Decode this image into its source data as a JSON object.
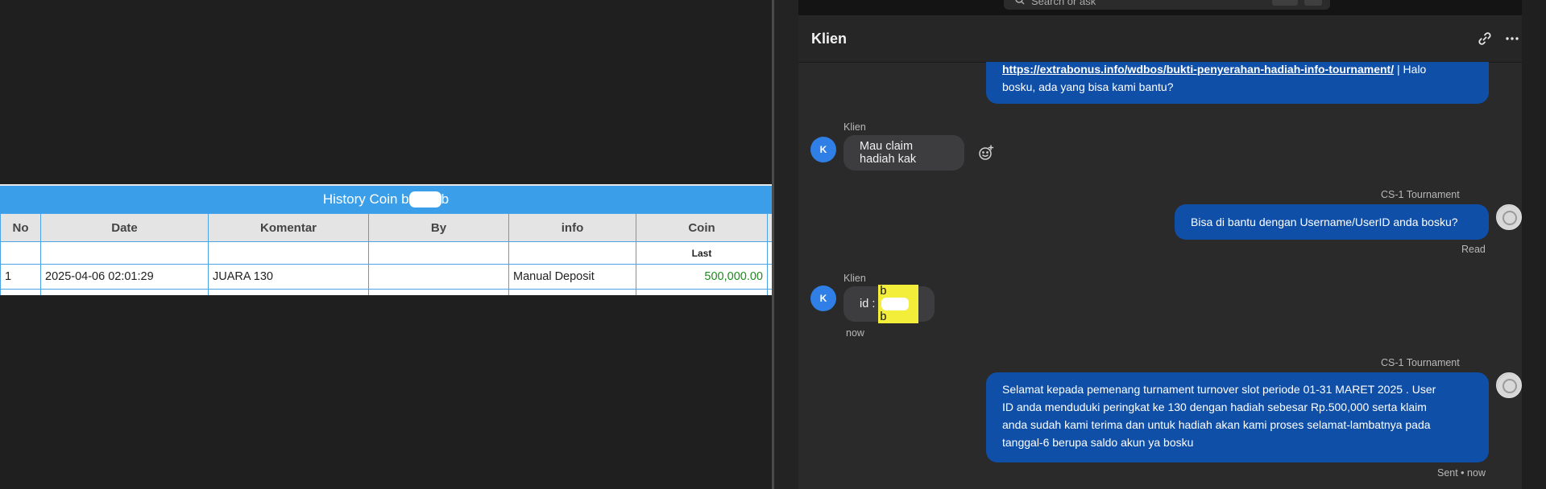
{
  "history": {
    "title_prefix": "History Coin b",
    "title_suffix": "b",
    "columns": [
      "No",
      "Date",
      "Komentar",
      "By",
      "info",
      "Coin"
    ],
    "subheader": "Last",
    "rows": [
      {
        "no": "1",
        "date": "2025-04-06 02:01:29",
        "komentar": "JUARA 130",
        "by": "",
        "info": "Manual Deposit",
        "coin": "500,000.00"
      }
    ]
  },
  "chat": {
    "search_placeholder": "Search or ask",
    "title": "Klien",
    "messages": {
      "m1_link": "https://extrabonus.info/wdbos/bukti-penyerahan-hadiah-info-tournament/",
      "m1_text_a": " | Halo",
      "m1_text_b": "bosku, ada yang bisa kami bantu?",
      "m2_sender": "Klien",
      "m2_avatar": "K",
      "m2_text": "Mau claim hadiah kak",
      "m3_sender": "CS-1 Tournament",
      "m3_text": "Bisa di bantu dengan Username/UserID anda bosku?",
      "m3_status": "Read",
      "m4_sender": "Klien",
      "m4_avatar": "K",
      "m4_prefix": "id : ",
      "m4_hl_a": "b",
      "m4_hl_b": "b",
      "m4_time": "now",
      "m5_sender": "CS-1 Tournament",
      "m5_line1": "Selamat kepada pemenang turnament turnover slot periode 01-31 MARET 2025 . User",
      "m5_line2": "ID anda menduduki peringkat ke 130 dengan hadiah sebesar Rp.500,000 serta klaim",
      "m5_line3": "anda sudah kami terima dan untuk hadiah akan kami proses selamat-lambatnya pada",
      "m5_line4": "tanggal-6 berupa saldo akun ya bosku",
      "m5_status": "Sent • now"
    }
  },
  "colors": {
    "table_header_blue": "#3a9fe8",
    "outgoing_bubble": "#0f4fa8",
    "incoming_bubble": "#3d3d3f",
    "coin_green": "#1e8a1e",
    "avatar_blue": "#2f7fe6"
  },
  "icons": {
    "link": "link-icon",
    "more": "more-horizontal-icon",
    "emoji": "add-reaction-icon",
    "search": "search-icon"
  }
}
